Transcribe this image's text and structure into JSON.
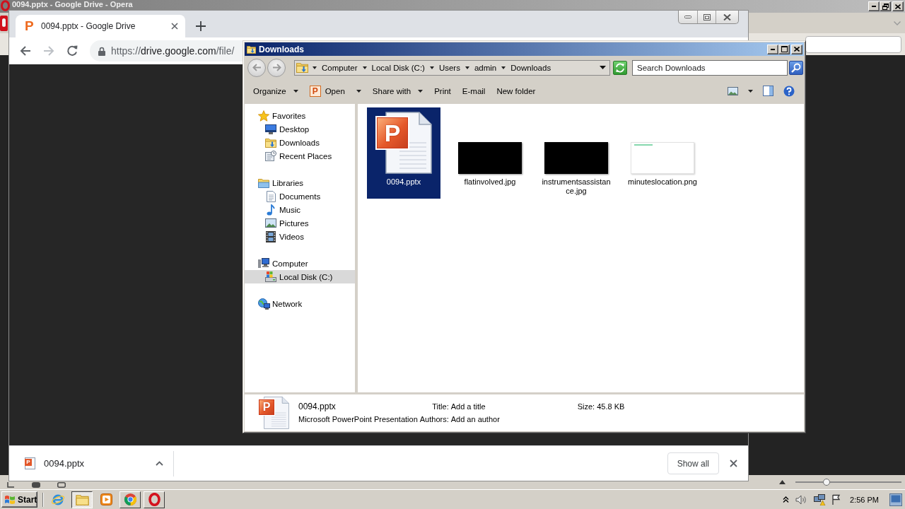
{
  "opera_window": {
    "title": "0094.pptx - Google Drive - Opera",
    "maximized": true,
    "zoom_slider": {
      "level": 0.28
    }
  },
  "browser": {
    "maximized": false,
    "tabs": [
      {
        "favicon_letter": "P",
        "title": "0094.pptx - Google Drive",
        "selected": true
      }
    ],
    "nav_buttons": [
      {
        "kind": "back",
        "disabled": false
      },
      {
        "kind": "forward",
        "disabled": true
      },
      {
        "kind": "reload",
        "disabled": false
      }
    ],
    "address": {
      "scheme": "https://",
      "host": "drive.google.com",
      "path": "/file/"
    },
    "downloads": [
      {
        "icon_letter": "P",
        "name": "0094.pptx"
      }
    ],
    "show_all": "Show all"
  },
  "explorer": {
    "title": "Downloads",
    "maximized": false,
    "nav_buttons": [
      {
        "kind": "back",
        "disabled": true
      },
      {
        "kind": "forward",
        "disabled": true
      }
    ],
    "breadcrumb": [
      "Computer",
      "Local Disk (C:)",
      "Users",
      "admin",
      "Downloads"
    ],
    "search": {
      "placeholder": "Search Downloads"
    },
    "toolbar": [
      {
        "label": "Organize",
        "kind": "menu"
      },
      {
        "label": "Open",
        "kind": "split",
        "icon_letter": "P"
      },
      {
        "label": "Share with",
        "kind": "menu"
      },
      {
        "label": "Print",
        "kind": "plain"
      },
      {
        "label": "E-mail",
        "kind": "plain"
      },
      {
        "label": "New folder",
        "kind": "plain"
      }
    ],
    "nav": [
      {
        "label": "Favorites",
        "kind": "star",
        "selected": false,
        "children": [
          {
            "label": "Desktop",
            "kind": "desktop",
            "selected": false
          },
          {
            "label": "Downloads",
            "kind": "download",
            "selected": false
          },
          {
            "label": "Recent Places",
            "kind": "recent",
            "selected": false
          }
        ]
      },
      {
        "label": "Libraries",
        "kind": "library",
        "selected": false,
        "children": [
          {
            "label": "Documents",
            "kind": "document",
            "selected": false
          },
          {
            "label": "Music",
            "kind": "music",
            "selected": false
          },
          {
            "label": "Pictures",
            "kind": "picture",
            "selected": false
          },
          {
            "label": "Videos",
            "kind": "video",
            "selected": false
          }
        ]
      },
      {
        "label": "Computer",
        "kind": "computer",
        "selected": false,
        "children": [
          {
            "label": "Local Disk (C:)",
            "kind": "disk",
            "selected": true
          }
        ]
      },
      {
        "label": "Network",
        "kind": "network",
        "selected": false
      }
    ],
    "files": [
      {
        "name": "0094.pptx",
        "kind": "presentation",
        "icon_letter": "P",
        "selected": true
      },
      {
        "name": "flatinvolved.jpg",
        "kind": "dark",
        "selected": false
      },
      {
        "name": "instrumentsassistance.jpg",
        "kind": "dark",
        "selected": false
      },
      {
        "name": "minuteslocation.png",
        "kind": "light",
        "selected": false
      }
    ],
    "details": {
      "icon_letter": "P",
      "name": "0094.pptx",
      "type": "Microsoft PowerPoint Presentation",
      "fields": [
        {
          "label": "Title:",
          "value": "Add a title"
        },
        {
          "label": "Authors:",
          "value": "Add an author"
        },
        {
          "label": "Size:",
          "value": "45.8 KB"
        }
      ]
    }
  },
  "taskbar": {
    "start": "Start",
    "buttons": [
      {
        "kind": "globe",
        "open": false,
        "selected": false
      },
      {
        "kind": "folder",
        "open": true,
        "selected": true
      },
      {
        "kind": "player",
        "open": false,
        "selected": false
      },
      {
        "kind": "tricolor",
        "open": true,
        "selected": false
      },
      {
        "kind": "redring",
        "open": true,
        "selected": false
      }
    ],
    "clock": "2:56 PM"
  }
}
